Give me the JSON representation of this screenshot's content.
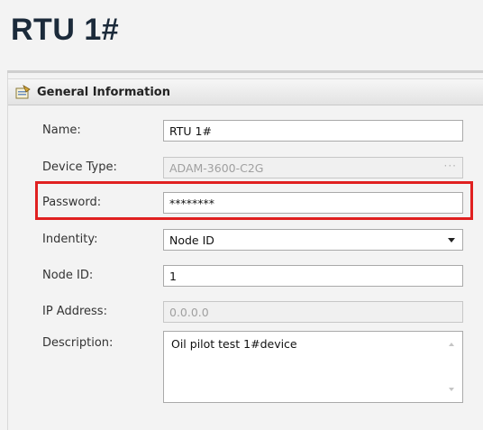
{
  "page": {
    "title": "RTU 1#"
  },
  "section": {
    "title": "General Information",
    "icon": "properties-icon"
  },
  "fields": {
    "name": {
      "label": "Name:",
      "value": "RTU 1#"
    },
    "device_type": {
      "label": "Device Type:",
      "value": "ADAM-3600-C2G",
      "button": "···"
    },
    "password": {
      "label": "Password:",
      "value": "********"
    },
    "identity": {
      "label": "Indentity:",
      "value": "Node ID"
    },
    "node_id": {
      "label": "Node ID:",
      "value": "1"
    },
    "ip_address": {
      "label": "IP Address:",
      "value": "0.0.0.0"
    },
    "description": {
      "label": "Description:",
      "value": "Oil pilot test 1#device"
    }
  },
  "colors": {
    "highlight": "#e02020",
    "title": "#1b2a3a"
  }
}
